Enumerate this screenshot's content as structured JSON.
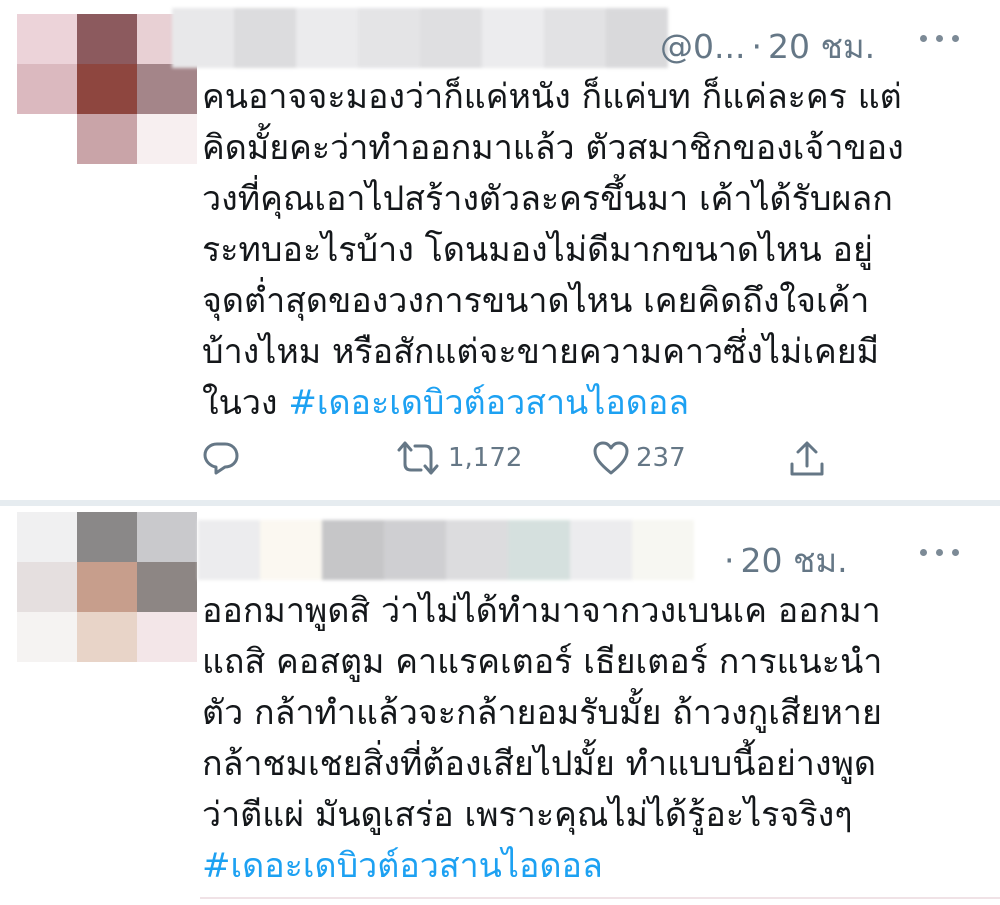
{
  "tweets": [
    {
      "handle": "@0...",
      "separator": "·",
      "time": "20 ชม.",
      "lines": [
        "คนอาจจะมองว่าก็แค่หนัง ก็แค่บท ก็แค่ละคร แต่",
        "คิดมั้ยคะว่าทำออกมาแล้ว ตัวสมาชิกของเจ้าของ",
        "วงที่คุณเอาไปสร้างตัวละครขึ้นมา เค้าได้รับผลก",
        "ระทบอะไรบ้าง โดนมองไม่ดีมากขนาดไหน อยู่",
        "จุดต่ำสุดของวงการขนาดไหน เคยคิดถึงใจเค้า",
        "บ้างไหม หรือสักแต่จะขายความคาวซึ่งไม่เคยมี"
      ],
      "last_line_prefix": "ในวง",
      "hashtag": "#เดอะเดบิวต์อวสานไอดอล",
      "retweets": "1,172",
      "likes": "237"
    },
    {
      "separator": "·",
      "time": "20 ชม.",
      "lines": [
        "ออกมาพูดสิ ว่าไม่ได้ทำมาจากวงเบนเค ออกมา",
        "แถสิ คอสตูม คาแรคเตอร์ เธียเตอร์  การแนะนำ",
        "ตัว กล้าทำแล้วจะกล้ายอมรับมั้ย ถ้าวงกูเสียหาย",
        "กล้าชมเชยสิ่งที่ต้องเสียไปมั้ย ทำแบบนี้อย่างพูด",
        "ว่าตีแผ่ มันดูเสร่อ เพราะคุณไม่ได้รู้อะไรจริงๆ"
      ],
      "hashtag": "#เดอะเดบิวต์อวสานไอดอล"
    }
  ],
  "icons": {
    "reply": "reply-icon",
    "retweet": "retweet-icon",
    "like": "heart-icon",
    "share": "share-icon",
    "more": "more-icon"
  },
  "colors": {
    "hashtag": "#1da1f2",
    "meta": "#657786",
    "text": "#14171a"
  }
}
